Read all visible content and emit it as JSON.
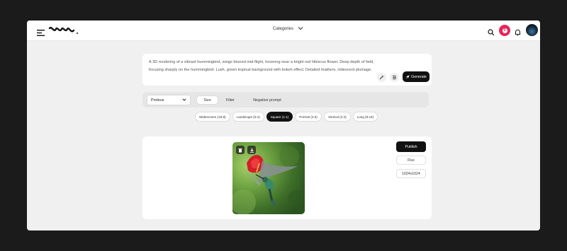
{
  "header": {
    "categories_label": "Categories",
    "notification_count": "0"
  },
  "prompt": {
    "text": "A 3D rendering of a vibrant hummingbird, wings blurred mid-flight, hovering near a bright red hibiscus flower.  Deep depth of field, focusing sharply on the hummingbird.  Lush, green tropical background with bokeh effect.  Detailed feathers, iridescent plumage.",
    "generate_label": "Generate"
  },
  "options": {
    "model": "Proteus",
    "tabs": [
      "Size",
      "Filter",
      "Negative prompt"
    ],
    "active_tab": "Size"
  },
  "sizes": [
    "Widescreen (16:9)",
    "Landscape (5:4)",
    "Square (1:1)",
    "Portrait (4:5)",
    "Vertical (2:3)",
    "Long (9:16)"
  ],
  "active_size": "Square (1:1)",
  "result": {
    "publish_label": "Publish",
    "model_tag": "Flux",
    "resolution": "1024x1024"
  },
  "colors": {
    "accent": "#e8255a",
    "primary_button": "#111111",
    "background": "#f0f0f0"
  }
}
